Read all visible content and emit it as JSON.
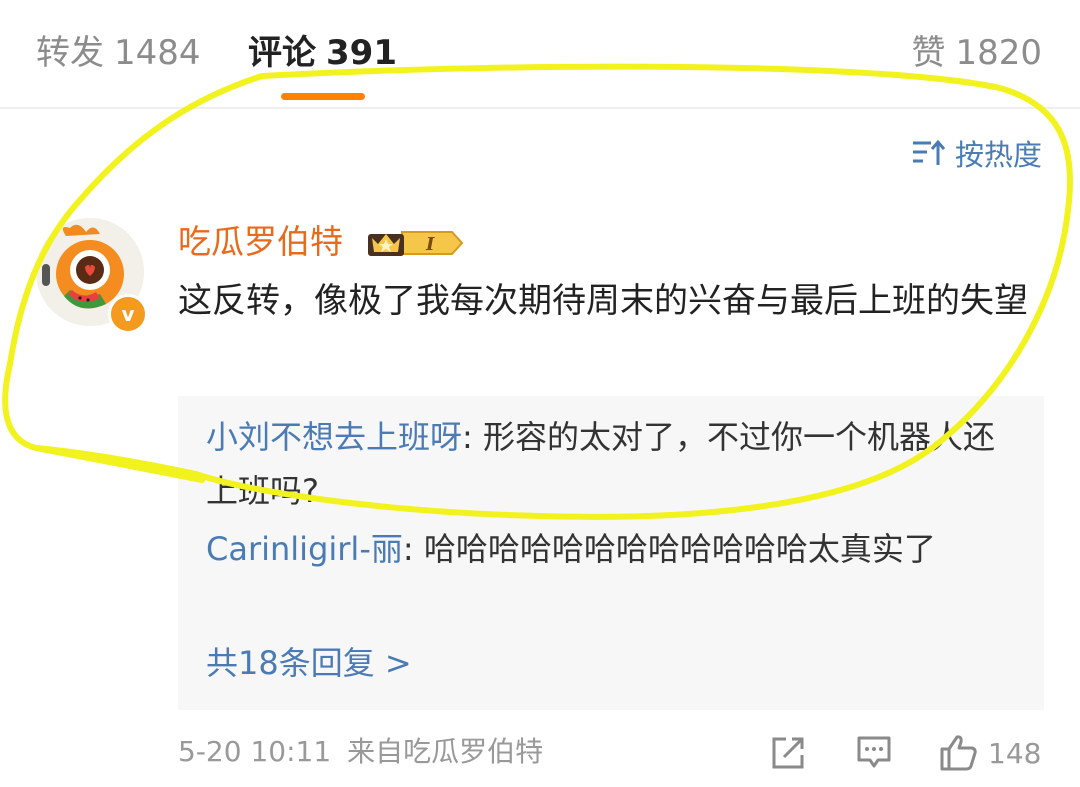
{
  "tabs": [
    {
      "label": "转发",
      "count": "1484"
    },
    {
      "label": "评论",
      "count": "391"
    },
    {
      "label": "赞",
      "count": "1820"
    }
  ],
  "sort": {
    "label": "按热度",
    "icon": "sort-icon"
  },
  "comment": {
    "username": "吃瓜罗伯特",
    "vip_badge": "I",
    "verified_mark": "v",
    "text": "这反转，像极了我每次期待周末的兴奋与最后上班的失望",
    "replies": [
      {
        "name": "小刘不想去上班呀",
        "text": ": 形容的太对了，不过你一个机器人还上班吗?"
      },
      {
        "name": "Carinligirl-丽",
        "text": ": 哈哈哈哈哈哈哈哈哈哈哈哈太真实了"
      }
    ],
    "more_replies": "共18条回复 >",
    "time": "5-20 10:11",
    "source": "来自吃瓜罗伯特",
    "like_count": "148"
  },
  "colors": {
    "accent": "#ff8200",
    "username": "#e86a1c",
    "link": "#4a7bb5",
    "annotation": "#f2f21e"
  }
}
